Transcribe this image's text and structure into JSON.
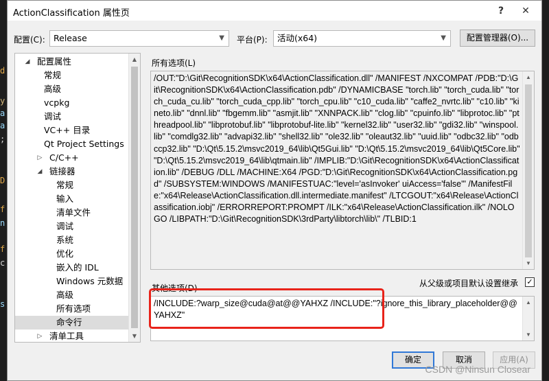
{
  "window": {
    "title": "ActionClassification 属性页"
  },
  "titlebar": {
    "help_glyph": "?",
    "close_glyph": "✕"
  },
  "config_bar": {
    "config_label": "配置(C):",
    "config_value": "Release",
    "platform_label": "平台(P):",
    "platform_value": "活动(x64)",
    "manager_button": "配置管理器(O)..."
  },
  "tree": {
    "items": [
      {
        "label": "配置属性",
        "expander": "◢"
      },
      {
        "label": "常规"
      },
      {
        "label": "高级"
      },
      {
        "label": "vcpkg"
      },
      {
        "label": "调试"
      },
      {
        "label": "VC++ 目录"
      },
      {
        "label": "Qt Project Settings"
      },
      {
        "label": "C/C++",
        "expander": "▷"
      },
      {
        "label": "链接器",
        "expander": "◢"
      },
      {
        "label": "常规"
      },
      {
        "label": "输入"
      },
      {
        "label": "清单文件"
      },
      {
        "label": "调试"
      },
      {
        "label": "系统"
      },
      {
        "label": "优化"
      },
      {
        "label": "嵌入的 IDL"
      },
      {
        "label": "Windows 元数据"
      },
      {
        "label": "高级"
      },
      {
        "label": "所有选项"
      },
      {
        "label": "命令行"
      },
      {
        "label": "清单工具",
        "expander": "▷"
      }
    ]
  },
  "all_options": {
    "label": "所有选项(L)",
    "text": "/OUT:\"D:\\Git\\RecognitionSDK\\x64\\ActionClassification.dll\" /MANIFEST /NXCOMPAT /PDB:\"D:\\Git\\RecognitionSDK\\x64\\ActionClassification.pdb\" /DYNAMICBASE \"torch.lib\" \"torch_cuda.lib\" \"torch_cuda_cu.lib\" \"torch_cuda_cpp.lib\" \"torch_cpu.lib\" \"c10_cuda.lib\" \"caffe2_nvrtc.lib\" \"c10.lib\" \"kineto.lib\" \"dnnl.lib\" \"fbgemm.lib\" \"asmjit.lib\" \"XNNPACK.lib\" \"clog.lib\" \"cpuinfo.lib\" \"libprotoc.lib\" \"pthreadpool.lib\" \"libprotobuf.lib\" \"libprotobuf-lite.lib\" \"kernel32.lib\" \"user32.lib\" \"gdi32.lib\" \"winspool.lib\" \"comdlg32.lib\" \"advapi32.lib\" \"shell32.lib\" \"ole32.lib\" \"oleaut32.lib\" \"uuid.lib\" \"odbc32.lib\" \"odbccp32.lib\" \"D:\\Qt\\5.15.2\\msvc2019_64\\lib\\Qt5Gui.lib\" \"D:\\Qt\\5.15.2\\msvc2019_64\\lib\\Qt5Core.lib\" \"D:\\Qt\\5.15.2\\msvc2019_64\\lib\\qtmain.lib\" /IMPLIB:\"D:\\Git\\RecognitionSDK\\x64\\ActionClassification.lib\" /DEBUG /DLL /MACHINE:X64 /PGD:\"D:\\Git\\RecognitionSDK\\x64\\ActionClassification.pgd\" /SUBSYSTEM:WINDOWS /MANIFESTUAC:\"level='asInvoker' uiAccess='false'\" /ManifestFile:\"x64\\Release\\ActionClassification.dll.intermediate.manifest\" /LTCGOUT:\"x64\\Release\\ActionClassification.iobj\" /ERRORREPORT:PROMPT /ILK:\"x64\\Release\\ActionClassification.ilk\" /NOLOGO /LIBPATH:\"D:\\Git\\RecognitionSDK\\3rdParty\\libtorch\\lib\\\" /TLBID:1"
  },
  "other_options": {
    "label": "其他选项(D)",
    "inherit_label": "从父级或项目默认设置继承",
    "inherit_checked": true,
    "check_glyph": "✓",
    "text": "/INCLUDE:?warp_size@cuda@at@@YAHXZ /INCLUDE:\"?ignore_this_library_placeholder@@YAHXZ\""
  },
  "buttons": {
    "ok": "确定",
    "cancel": "取消",
    "apply": "应用(A)"
  },
  "watermark": "CSDN @Ninsun Closear",
  "colors": {
    "highlight": "#e8231a",
    "primary_border": "#3078d7"
  }
}
